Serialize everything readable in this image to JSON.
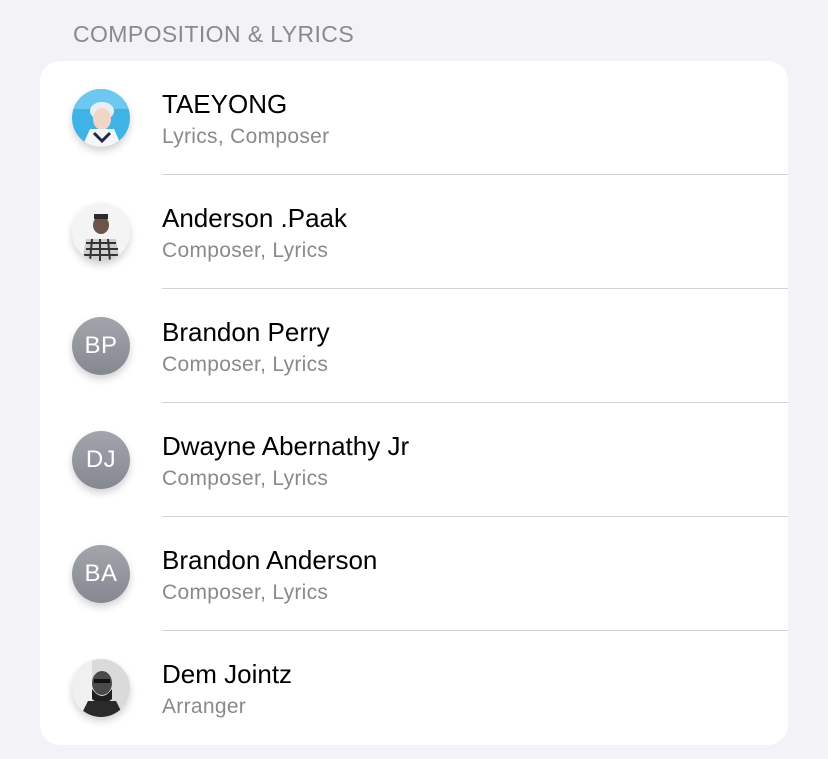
{
  "section": {
    "title": "COMPOSITION & LYRICS"
  },
  "credits": [
    {
      "name": "TAEYONG",
      "role": "Lyrics, Composer",
      "avatar": "photo-taeyong"
    },
    {
      "name": "Anderson .Paak",
      "role": "Composer, Lyrics",
      "avatar": "photo-anderson-paak"
    },
    {
      "name": "Brandon Perry",
      "role": "Composer, Lyrics",
      "initials": "BP"
    },
    {
      "name": "Dwayne Abernathy Jr",
      "role": "Composer, Lyrics",
      "initials": "DJ"
    },
    {
      "name": "Brandon Anderson",
      "role": "Composer, Lyrics",
      "initials": "BA"
    },
    {
      "name": "Dem Jointz",
      "role": "Arranger",
      "avatar": "photo-dem-jointz"
    }
  ],
  "colors": {
    "background": "#f2f2f7",
    "card": "#ffffff",
    "secondary_text": "#8a8a8e",
    "initials_avatar": "#969891"
  }
}
